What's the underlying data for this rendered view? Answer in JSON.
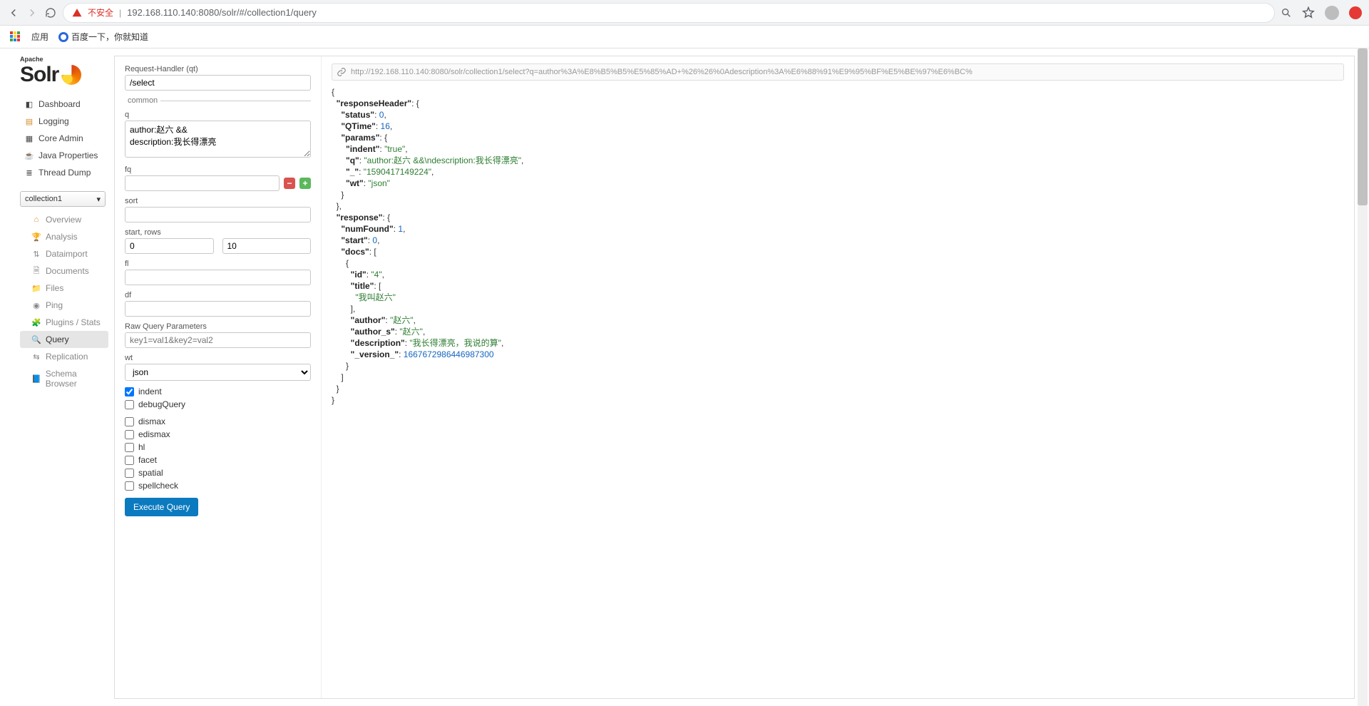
{
  "chrome": {
    "insecure_label": "不安全",
    "url": "192.168.110.140:8080/solr/#/collection1/query"
  },
  "bookmarks": {
    "apps": "应用",
    "baidu": "百度一下，你就知道"
  },
  "logo": {
    "apache": "Apache",
    "solr": "Solr"
  },
  "nav": {
    "dashboard": "Dashboard",
    "logging": "Logging",
    "core_admin": "Core Admin",
    "java_props": "Java Properties",
    "thread_dump": "Thread Dump"
  },
  "core_selected": "collection1",
  "sub_nav": {
    "overview": "Overview",
    "analysis": "Analysis",
    "dataimport": "Dataimport",
    "documents": "Documents",
    "files": "Files",
    "ping": "Ping",
    "plugins": "Plugins / Stats",
    "query": "Query",
    "replication": "Replication",
    "schema": "Schema Browser"
  },
  "form": {
    "qt_label": "Request-Handler (qt)",
    "qt_value": "/select",
    "common_legend": "common",
    "q_label": "q",
    "q_value": "author:赵六 &&\ndescription:我长得漂亮",
    "fq_label": "fq",
    "sort_label": "sort",
    "startrows_label": "start, rows",
    "start_value": "0",
    "rows_value": "10",
    "fl_label": "fl",
    "df_label": "df",
    "raw_label": "Raw Query Parameters",
    "raw_placeholder": "key1=val1&key2=val2",
    "wt_label": "wt",
    "wt_value": "json",
    "indent": "indent",
    "debugQuery": "debugQuery",
    "dismax": "dismax",
    "edismax": "edismax",
    "hl": "hl",
    "facet": "facet",
    "spatial": "spatial",
    "spellcheck": "spellcheck",
    "execute": "Execute Query"
  },
  "result_url": "http://192.168.110.140:8080/solr/collection1/select?q=author%3A%E8%B5%B5%E5%85%AD+%26%26%0Adescription%3A%E6%88%91%E9%95%BF%E5%BE%97%E6%BC%",
  "response": {
    "responseHeader": {
      "status": 0,
      "QTime": 16,
      "params": {
        "indent": "true",
        "q": "author:赵六 &&\\ndescription:我长得漂亮",
        "_": "1590417149224",
        "wt": "json"
      }
    },
    "response": {
      "numFound": 1,
      "start": 0,
      "docs": [
        {
          "id": "4",
          "title": [
            "我叫赵六"
          ],
          "author": "赵六",
          "author_s": "赵六",
          "description": "我长得漂亮，我说的算",
          "_version_": 1667672986446987300
        }
      ]
    }
  }
}
